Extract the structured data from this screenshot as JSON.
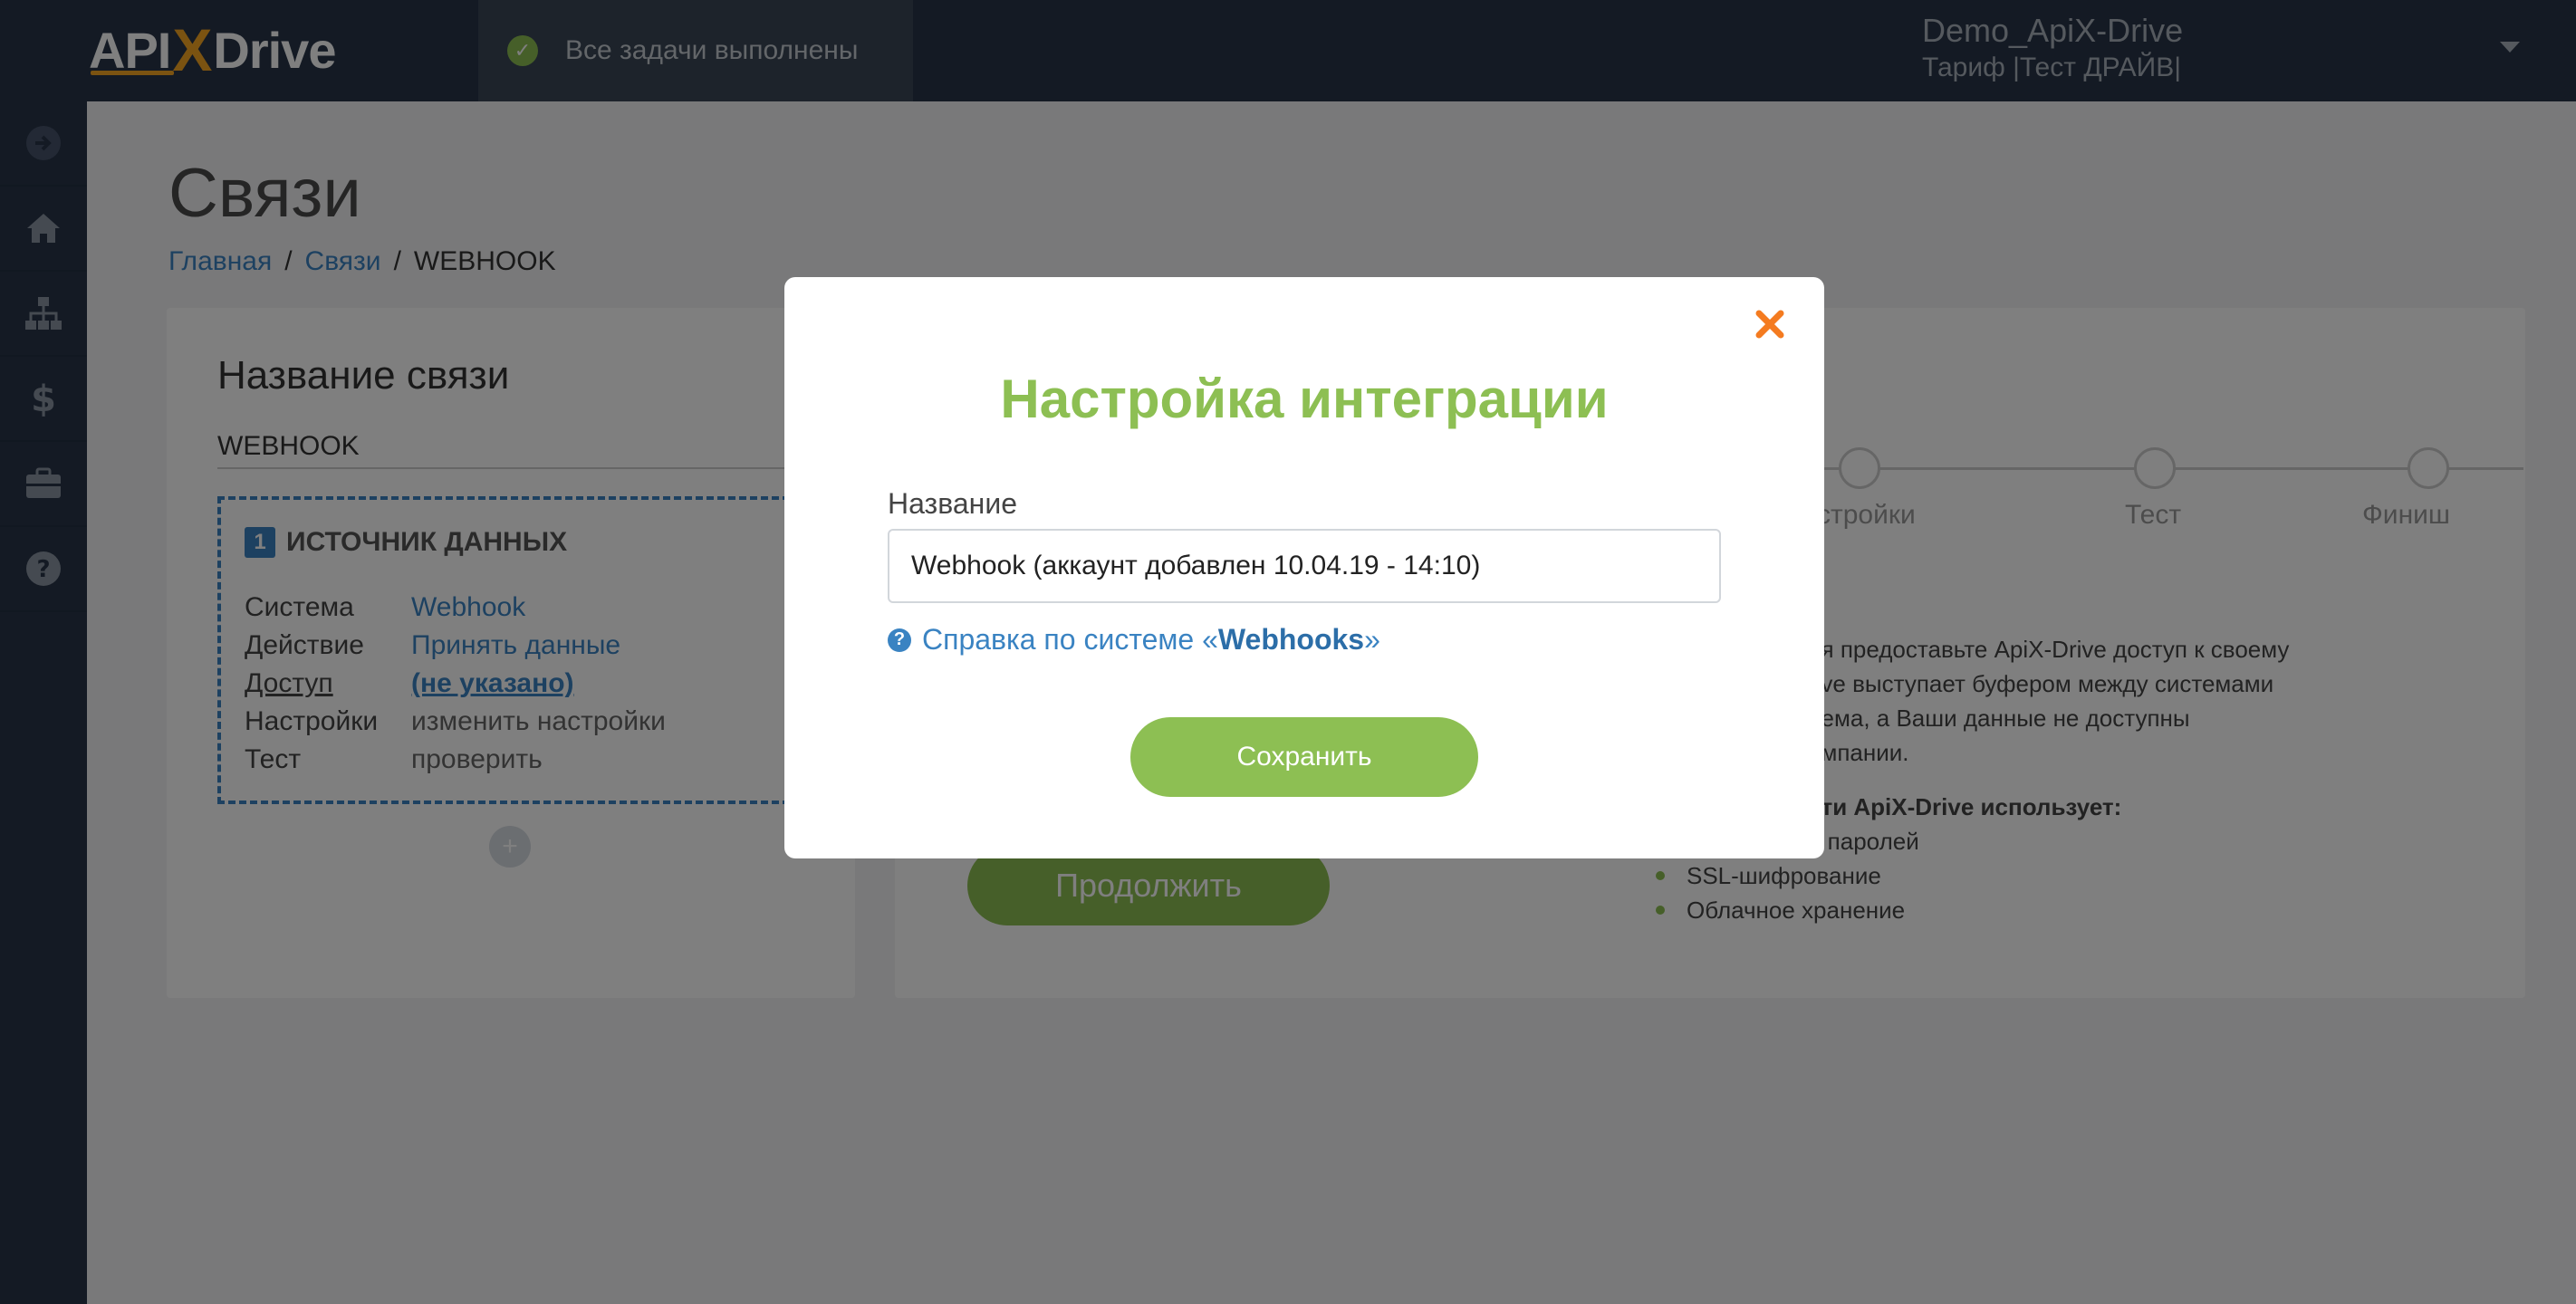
{
  "header": {
    "logo_left": "API",
    "logo_x": "X",
    "logo_right": "Drive",
    "status_text": "Все задачи выполнены",
    "account_name": "Demo_ApiX-Drive",
    "account_plan": "Тариф |Тест ДРАЙВ|"
  },
  "sidebar": {
    "items": [
      {
        "icon": "arrow-right-circle-icon"
      },
      {
        "icon": "home-icon"
      },
      {
        "icon": "sitemap-icon"
      },
      {
        "icon": "dollar-icon"
      },
      {
        "icon": "briefcase-icon"
      },
      {
        "icon": "question-circle-icon"
      }
    ]
  },
  "page": {
    "title": "Связи",
    "breadcrumb": [
      "Главная",
      "Связи",
      "WEBHOOK"
    ],
    "connection_title": "Название связи",
    "connection_name": "WEBHOOK",
    "source": {
      "number": "1",
      "heading": "ИСТОЧНИК ДАННЫХ",
      "rows": [
        {
          "label": "Система",
          "value": "Webhook"
        },
        {
          "label": "Действие",
          "value": "Принять данные"
        },
        {
          "label": "Доступ",
          "value": "(не указано)"
        },
        {
          "label": "Настройки",
          "value": "изменить настройки"
        },
        {
          "label": "Тест",
          "value": "проверить"
        }
      ]
    },
    "steps": [
      "стройки",
      "Тест",
      "Финиш"
    ],
    "info_lines": [
      "ия предоставьте ApiX-Drive доступ к своему",
      "rive выступает буфером между системами",
      "иема, а Ваши данные не доступны",
      "омпании."
    ],
    "security_heading": "сти ApiX-Drive использует:",
    "security_items": [
      "е паролей",
      "SSL-шифрование",
      "Облачное хранение"
    ],
    "continue_label": "Продолжить"
  },
  "modal": {
    "title": "Настройка интеграции",
    "name_label": "Название",
    "name_value": "Webhook (аккаунт добавлен 10.04.19 - 14:10)",
    "help_prefix": "Справка по системе «",
    "help_system": "Webhooks",
    "help_suffix": "»",
    "save_label": "Сохранить",
    "title_color": "#8dbf53",
    "close_color": "#f47b20"
  }
}
